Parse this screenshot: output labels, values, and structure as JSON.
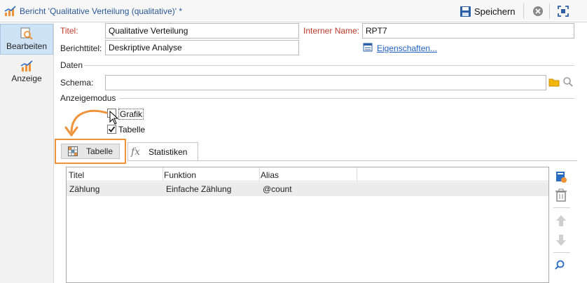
{
  "window": {
    "title": "Bericht 'Qualitative Verteilung (qualitative)' *",
    "save_label": "Speichern"
  },
  "sidebar": {
    "items": [
      {
        "label": "Bearbeiten",
        "icon": "edit-search-icon",
        "active": true
      },
      {
        "label": "Anzeige",
        "icon": "chart-icon",
        "active": false
      }
    ]
  },
  "form": {
    "titel_label": "Titel:",
    "titel_value": "Qualitative Verteilung",
    "berichttitel_label": "Berichttitel:",
    "berichttitel_value": "Deskriptive Analyse",
    "interner_name_label": "Interner Name:",
    "interner_name_value": "RPT7",
    "eigenschaften_link": "Eigenschaften..."
  },
  "daten": {
    "section_label": "Daten",
    "schema_label": "Schema:",
    "schema_value": ""
  },
  "anzeigemodus": {
    "section_label": "Anzeigemodus",
    "options": [
      {
        "label": "Grafik",
        "checked": false
      },
      {
        "label": "Tabelle",
        "checked": true
      }
    ]
  },
  "tabs": [
    {
      "label": "Tabelle",
      "icon": "table-icon"
    },
    {
      "label": "Statistiken",
      "icon": "fx-icon",
      "icon_text": "fx"
    }
  ],
  "table": {
    "columns": [
      "Titel",
      "Funktion",
      "Alias"
    ],
    "rows": [
      [
        "Zählung",
        "Einfache Zählung",
        "@count"
      ]
    ]
  },
  "right_toolbar": [
    "add-icon",
    "delete-icon",
    "move-up-icon",
    "move-down-icon",
    "search-icon"
  ],
  "colors": {
    "accent_orange": "#f0923a",
    "link_blue": "#1f5fbf",
    "required_red": "#c0392b"
  }
}
